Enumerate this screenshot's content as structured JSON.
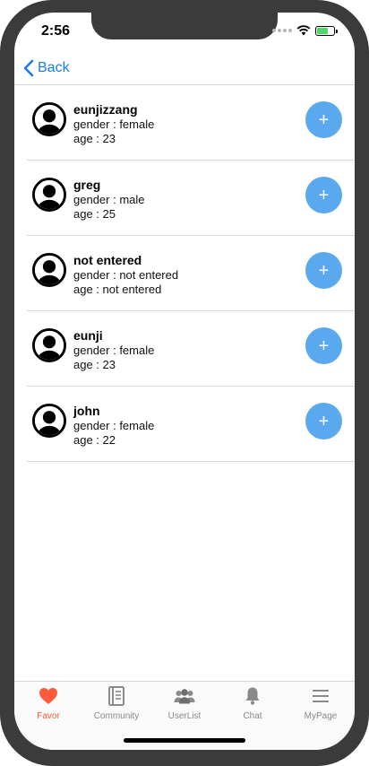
{
  "status": {
    "time": "2:56"
  },
  "nav": {
    "back_label": "Back"
  },
  "users": [
    {
      "name": "eunjizzang",
      "gender": "gender : female",
      "age": "age : 23"
    },
    {
      "name": "greg",
      "gender": "gender : male",
      "age": "age : 25"
    },
    {
      "name": "not entered",
      "gender": "gender : not entered",
      "age": "age : not entered"
    },
    {
      "name": "eunji",
      "gender": "gender : female",
      "age": "age : 23"
    },
    {
      "name": "john",
      "gender": "gender : female",
      "age": "age : 22"
    }
  ],
  "add_button_symbol": "+",
  "tabs": [
    {
      "label": "Favor",
      "icon": "heart-icon",
      "active": true
    },
    {
      "label": "Community",
      "icon": "book-icon",
      "active": false
    },
    {
      "label": "UserList",
      "icon": "users-icon",
      "active": false
    },
    {
      "label": "Chat",
      "icon": "bell-icon",
      "active": false
    },
    {
      "label": "MyPage",
      "icon": "menu-icon",
      "active": false
    }
  ],
  "colors": {
    "accent": "#1a7cf0",
    "add_button": "#5aa9ef",
    "active_tab": "#ff5a3c",
    "inactive_tab": "#888888"
  }
}
